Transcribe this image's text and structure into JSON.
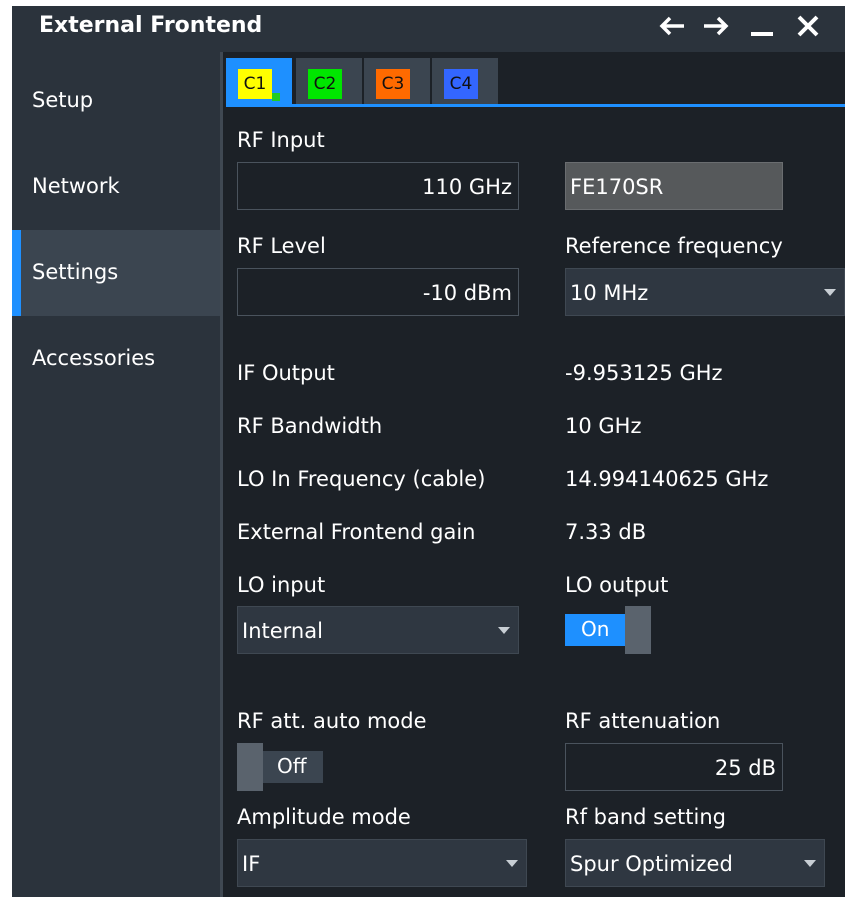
{
  "window": {
    "title": "External Frontend",
    "controls": [
      "back-arrow-icon",
      "forward-arrow-icon",
      "minimize-icon",
      "close-icon"
    ]
  },
  "sidebar": {
    "items": [
      {
        "label": "Setup",
        "active": false
      },
      {
        "label": "Network",
        "active": false
      },
      {
        "label": "Settings",
        "active": true
      },
      {
        "label": "Accessories",
        "active": false
      }
    ]
  },
  "tabs": [
    {
      "label": "C1",
      "color": "#ffff00",
      "active": true
    },
    {
      "label": "C2",
      "color": "#00e600",
      "active": false
    },
    {
      "label": "C3",
      "color": "#ff6a00",
      "active": false
    },
    {
      "label": "C4",
      "color": "#3366ff",
      "active": false
    }
  ],
  "form": {
    "rf_input": {
      "label": "RF Input",
      "value": "110 GHz",
      "model": "FE170SR"
    },
    "rf_level": {
      "label": "RF Level",
      "value": "-10 dBm"
    },
    "reference_frequency": {
      "label": "Reference frequency",
      "value": "10 MHz"
    },
    "if_output": {
      "label": "IF Output",
      "value": "-9.953125 GHz"
    },
    "rf_bandwidth": {
      "label": "RF Bandwidth",
      "value": "10 GHz"
    },
    "lo_in_frequency": {
      "label": "LO In Frequency (cable)",
      "value": "14.994140625 GHz"
    },
    "frontend_gain": {
      "label": "External Frontend gain",
      "value": "7.33 dB"
    },
    "lo_input": {
      "label": "LO input",
      "value": "Internal"
    },
    "lo_output": {
      "label": "LO output",
      "state": "On"
    },
    "rf_att_auto": {
      "label": "RF att. auto mode",
      "state": "Off"
    },
    "rf_attenuation": {
      "label": "RF attenuation",
      "value": "25 dB"
    },
    "amplitude_mode": {
      "label": "Amplitude mode",
      "value": "IF"
    },
    "rf_band_setting": {
      "label": "Rf band setting",
      "value": "Spur Optimized"
    }
  },
  "colors": {
    "accent": "#1e90ff",
    "background": "#1c2127",
    "panel": "#2b333c"
  }
}
